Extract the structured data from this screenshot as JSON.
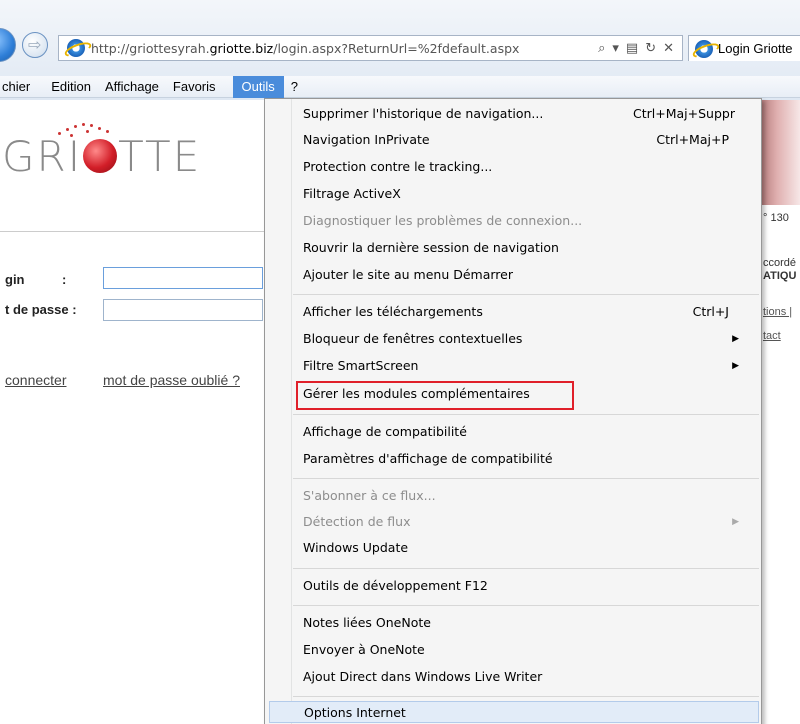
{
  "browser": {
    "url_prefix": "http://griottesyrah.",
    "url_host": "griotte.biz",
    "url_path": "/login.aspx?ReturnUrl=%2fdefault.aspx",
    "tab_title": "Login Griotte",
    "address_icons": {
      "search": "⌕",
      "dropdown": "▾",
      "compat": "▤",
      "refresh": "↻",
      "stop": "✕"
    }
  },
  "menubar": {
    "items": [
      "chier",
      "Edition",
      "Affichage",
      "Favoris",
      "Outils",
      "?"
    ]
  },
  "page": {
    "logo_text_left": "GRI",
    "logo_text_right": "TTE",
    "login_label": "gin",
    "password_label": "t de passe :",
    "colon": ":",
    "connect_link": "connecter",
    "forgot_link": "mot de passe oublié ?",
    "right_fragments": {
      "number": "° 130",
      "accord": "ccordé",
      "atiq": "ATIQU",
      "tions": "tions |",
      "tact": "tact"
    }
  },
  "outils_menu": {
    "items": [
      {
        "label": "Supprimer l'historique de navigation...",
        "shortcut": "Ctrl+Maj+Suppr"
      },
      {
        "label": "Navigation InPrivate",
        "shortcut": "Ctrl+Maj+P"
      },
      {
        "label": "Protection contre le tracking..."
      },
      {
        "label": "Filtrage ActiveX"
      },
      {
        "label": "Diagnostiquer les problèmes de connexion..."
      },
      {
        "label": "Rouvrir la dernière session de navigation"
      },
      {
        "label": "Ajouter le site au menu Démarrer"
      },
      {
        "label": "Afficher les téléchargements",
        "shortcut": "Ctrl+J"
      },
      {
        "label": "Bloqueur de fenêtres contextuelles"
      },
      {
        "label": "Filtre SmartScreen"
      },
      {
        "label": "Gérer les modules complémentaires"
      },
      {
        "label": "Affichage de compatibilité"
      },
      {
        "label": "Paramètres d'affichage de compatibilité"
      },
      {
        "label": "S'abonner à ce flux..."
      },
      {
        "label": "Détection de flux"
      },
      {
        "label": "Windows Update"
      },
      {
        "label": "Outils de développement F12"
      },
      {
        "label": "Notes liées OneNote"
      },
      {
        "label": "Envoyer à OneNote"
      },
      {
        "label": "Ajout Direct dans Windows Live Writer"
      },
      {
        "label": "Options Internet"
      }
    ],
    "submenu_arrow": "▶"
  },
  "colors": {
    "menu_active": "#4a8cdb",
    "highlight_box": "#e0202a",
    "logo_red": "#d21e28"
  }
}
